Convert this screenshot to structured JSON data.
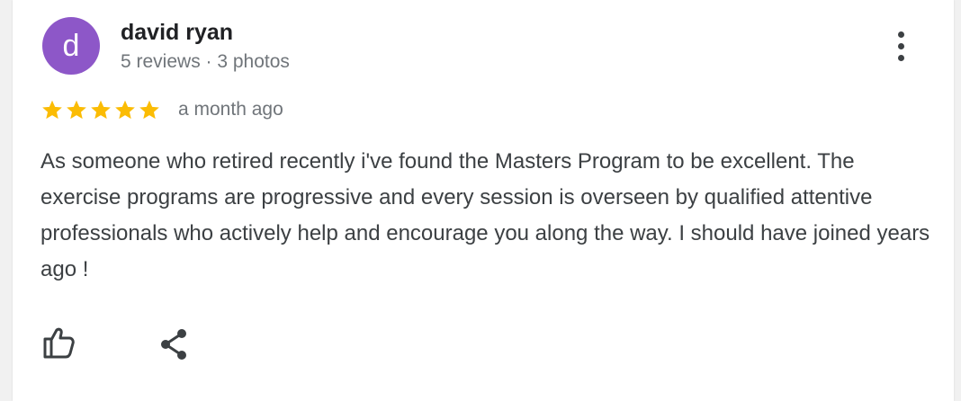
{
  "author": {
    "initial": "d",
    "name": "david ryan",
    "meta": "5 reviews · 3 photos",
    "avatar_color": "#8d57c8"
  },
  "review": {
    "rating": 5,
    "rating_max": 5,
    "star_color": "#fbbc04",
    "time": "a month ago",
    "text": "As someone who retired recently i've found the Masters Program to be excellent. The exercise programs are progressive and every session is overseen by qualified attentive professionals who actively help and encourage you along the way. I should have joined years ago !"
  },
  "actions": {
    "more_icon": "more-vert-icon",
    "like_icon": "thumb-up-icon",
    "share_icon": "share-icon"
  }
}
